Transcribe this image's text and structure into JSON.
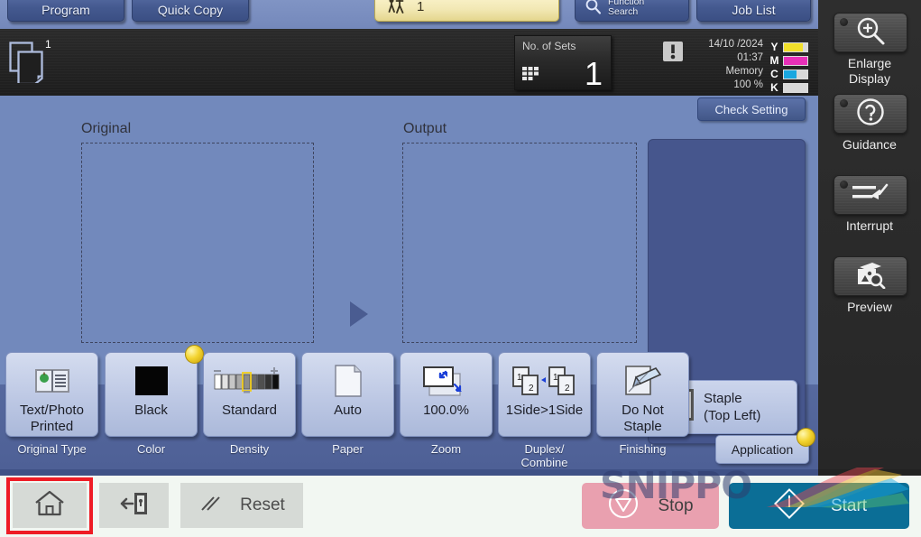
{
  "tabs": {
    "program": "Program",
    "quick_copy": "Quick Copy",
    "account_count": "1",
    "function_search_line1": "Function",
    "function_search_line2": "Search",
    "job_list": "Job List"
  },
  "status": {
    "copy_count": "1",
    "no_of_sets_label": "No. of Sets",
    "no_of_sets_value": "1",
    "date": "14/10 /2024",
    "time": "01:37",
    "memory_label": "Memory",
    "memory_value": "100 %",
    "toner": [
      {
        "key": "Y",
        "color": "#f2e02a",
        "level": 80
      },
      {
        "key": "M",
        "color": "#e830b8",
        "level": 100
      },
      {
        "key": "C",
        "color": "#1aa7e0",
        "level": 55
      },
      {
        "key": "K",
        "color": "#1d1d1d",
        "level": 0
      }
    ]
  },
  "main": {
    "check_setting": "Check Setting",
    "original_label": "Original",
    "output_label": "Output",
    "staple_line1": "Staple",
    "staple_line2": "(Top Left)",
    "application": "Application"
  },
  "functions": [
    {
      "label": "Text/Photo\nPrinted",
      "label_l1": "Text/Photo",
      "label_l2": "Printed",
      "caption": "Original Type",
      "caption_l2": "",
      "icon": "original-type-icon",
      "badge": false
    },
    {
      "label": "Black",
      "label_l1": "Black",
      "label_l2": "",
      "caption": "Color",
      "caption_l2": "",
      "icon": "color-swatch-icon",
      "badge": true
    },
    {
      "label": "Standard",
      "label_l1": "Standard",
      "label_l2": "",
      "caption": "Density",
      "caption_l2": "",
      "icon": "density-scale-icon",
      "badge": false
    },
    {
      "label": "Auto",
      "label_l1": "Auto",
      "label_l2": "",
      "caption": "Paper",
      "caption_l2": "",
      "icon": "paper-sheet-icon",
      "badge": false
    },
    {
      "label": "100.0%",
      "label_l1": "100.0%",
      "label_l2": "",
      "caption": "Zoom",
      "caption_l2": "",
      "icon": "zoom-scale-icon",
      "badge": false
    },
    {
      "label": "1Side>1Side",
      "label_l1": "1Side>1Side",
      "label_l2": "",
      "caption": "Duplex/",
      "caption_l2": "Combine",
      "icon": "duplex-icon",
      "badge": false
    },
    {
      "label": "Do Not Staple",
      "label_l1": "Do Not",
      "label_l2": "Staple",
      "caption": "Finishing",
      "caption_l2": "",
      "icon": "staple-icon",
      "badge": false
    }
  ],
  "hardkeys": [
    {
      "icon": "enlarge-display-icon",
      "caption_l1": "Enlarge",
      "caption_l2": "Display",
      "led": true
    },
    {
      "icon": "guidance-icon",
      "caption_l1": "Guidance",
      "caption_l2": "",
      "led": true
    },
    {
      "icon": "interrupt-icon",
      "caption_l1": "Interrupt",
      "caption_l2": "",
      "led": true
    },
    {
      "icon": "preview-icon",
      "caption_l1": "Preview",
      "caption_l2": "",
      "led": false
    }
  ],
  "bottom": {
    "home_icon": "home-icon",
    "logout_icon": "logout-icon",
    "reset_label": "Reset",
    "stop_label": "Stop",
    "start_label": "Start",
    "highlight_color": "#ee1c25"
  },
  "watermark": {
    "text": "SNIPPO"
  }
}
